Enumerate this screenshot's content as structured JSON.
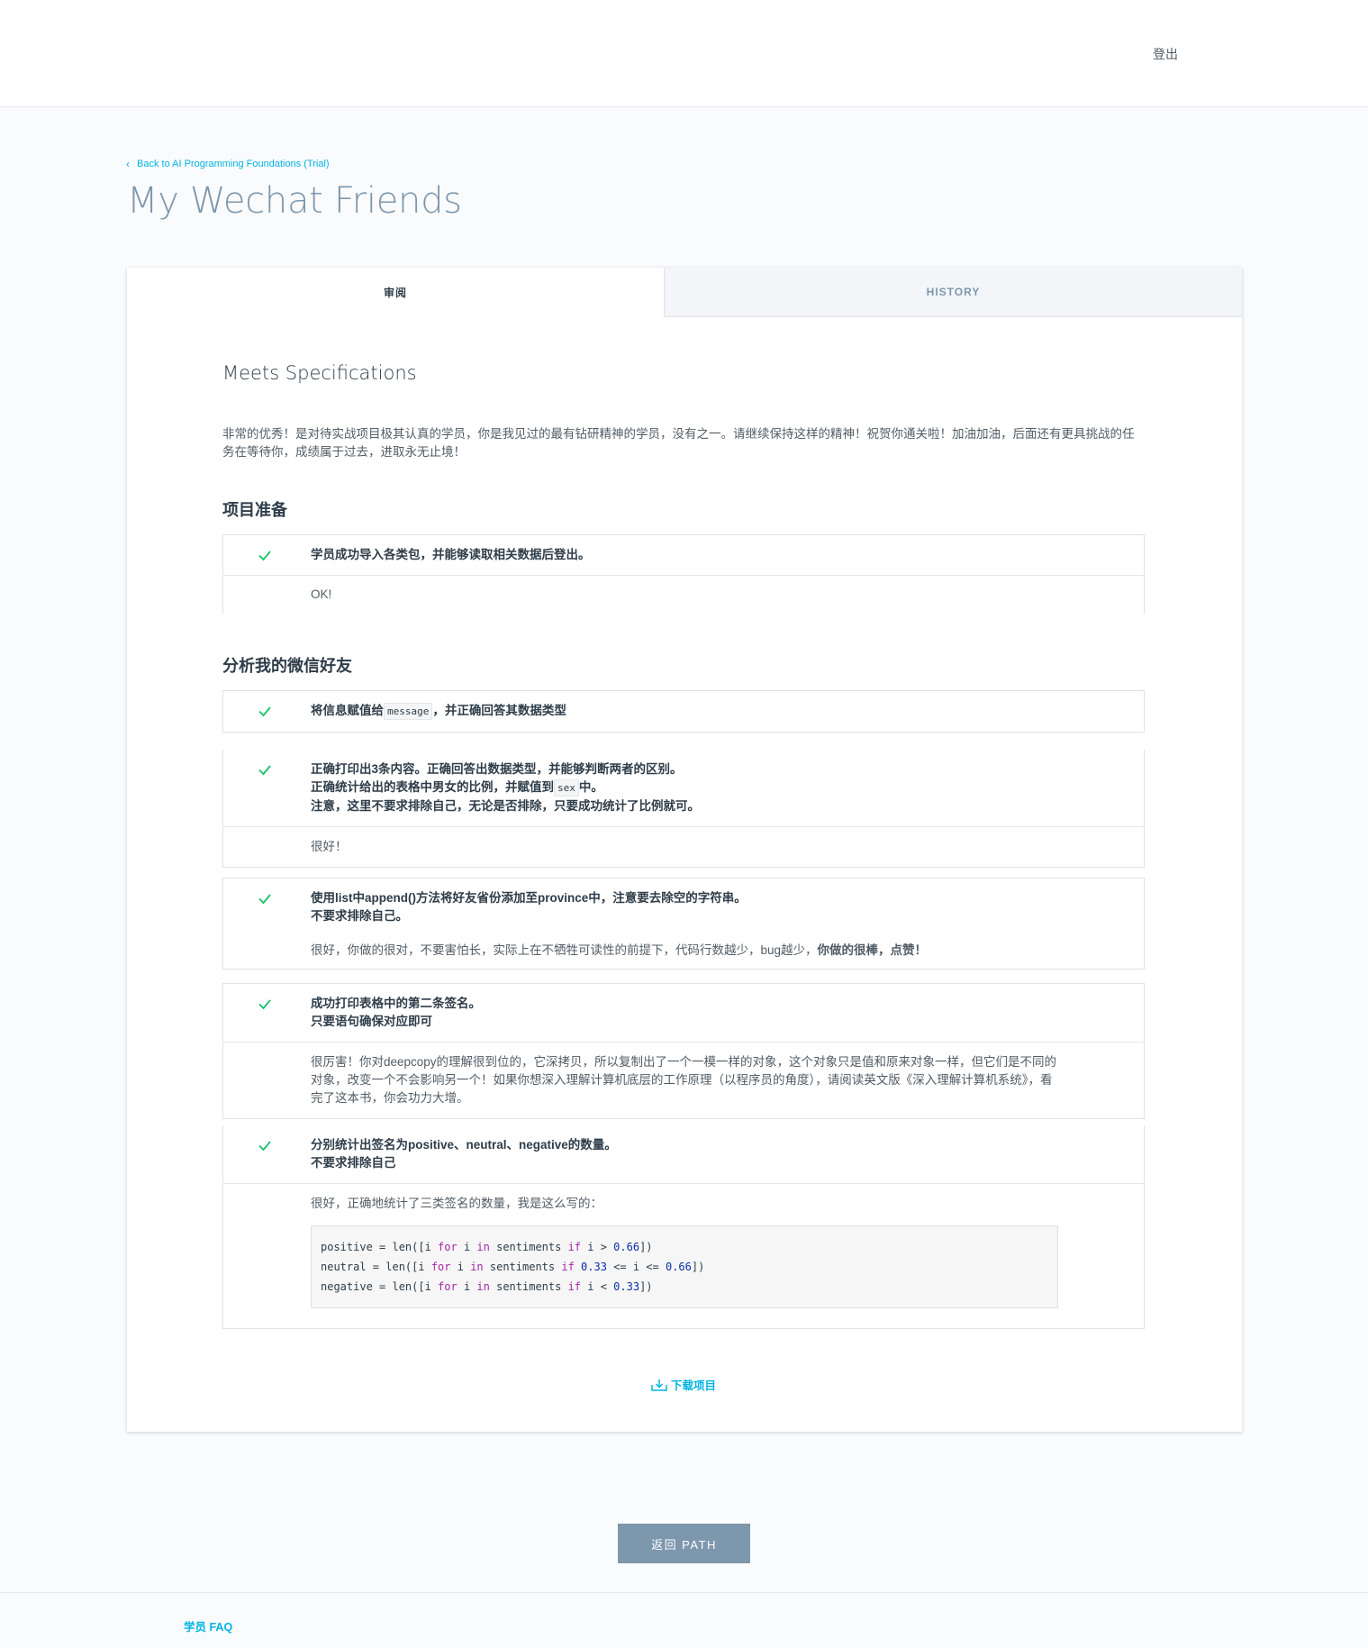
{
  "header": {
    "logout": "登出"
  },
  "nav": {
    "back_link": "Back to AI Programming Foundations (Trial)"
  },
  "page": {
    "title": "My Wechat Friends"
  },
  "tabs": {
    "review": "审阅",
    "history": "HISTORY"
  },
  "review": {
    "status": "Meets Specifications",
    "summary": "非常的优秀！是对待实战项目极其认真的学员，你是我见过的最有钻研精神的学员，没有之一。请继续保持这样的精神！祝贺你通关啦！加油加油，后面还有更具挑战的任务在等待你，成绩属于过去，进取永无止境！",
    "sections": [
      {
        "title": "项目准备",
        "items": [
          {
            "criterion": "学员成功导入各类包，并能够读取相关数据后登出。",
            "feedback": "OK!"
          }
        ]
      },
      {
        "title": "分析我的微信好友",
        "items": [
          {
            "criterion_before": "将信息赋值给",
            "criterion_code": "message",
            "criterion_after": "，并正确回答其数据类型"
          },
          {
            "criterion_line1": "正确打印出3条内容。正确回答出数据类型，并能够判断两者的区别。",
            "criterion_line2_before": "正确统计给出的表格中男女的比例，并赋值到",
            "criterion_line2_code": "sex",
            "criterion_line2_after": "中。",
            "criterion_line3": "注意，这里不要求排除自己，无论是否排除，只要成功统计了比例就可。",
            "feedback": "很好！"
          },
          {
            "criterion_line1": "使用list中append()方法将好友省份添加至province中，注意要去除空的字符串。",
            "criterion_line2": "不要求排除自己。",
            "feedback_plain": "很好，你做的很对，不要害怕长，实际上在不牺牲可读性的前提下，代码行数越少，bug越少，",
            "feedback_bold": "你做的很棒，点赞！"
          },
          {
            "criterion_line1": "成功打印表格中的第二条签名。",
            "criterion_line2": "只要语句确保对应即可",
            "feedback": "很厉害！你对deepcopy的理解很到位的，它深拷贝，所以复制出了一个一模一样的对象，这个对象只是值和原来对象一样，但它们是不同的对象，改变一个不会影响另一个！如果你想深入理解计算机底层的工作原理（以程序员的角度），请阅读英文版《深入理解计算机系统》，看完了这本书，你会功力大增。"
          },
          {
            "criterion_line1": "分别统计出签名为positive、neutral、negative的数量。",
            "criterion_line2": "不要求排除自己",
            "feedback": "很好，正确地统计了三类签名的数量，我是这么写的：",
            "code": {
              "l1_a": "positive = len([i ",
              "l1_kw1": "for",
              "l1_b": " i ",
              "l1_kw2": "in",
              "l1_c": " sentiments ",
              "l1_kw3": "if",
              "l1_d": " i > ",
              "l1_n1": "0.66",
              "l1_e": "])",
              "l2_a": "neutral = len([i ",
              "l2_kw1": "for",
              "l2_b": " i ",
              "l2_kw2": "in",
              "l2_c": " sentiments ",
              "l2_kw3": "if",
              "l2_d": " ",
              "l2_n1": "0.33",
              "l2_e": " <= i <= ",
              "l2_n2": "0.66",
              "l2_f": "])",
              "l3_a": "negative = len([i ",
              "l3_kw1": "for",
              "l3_b": " i ",
              "l3_kw2": "in",
              "l3_c": " sentiments ",
              "l3_kw3": "if",
              "l3_d": " i < ",
              "l3_n1": "0.33",
              "l3_e": "])"
            }
          }
        ]
      }
    ],
    "download": "下载项目"
  },
  "actions": {
    "return": "返回 PATH"
  },
  "footer": {
    "faq": "学员 FAQ"
  },
  "colors": {
    "accent": "#02b3e4",
    "check": "#15c26b",
    "title": "#7d97ad",
    "button": "#7d97ad"
  },
  "icons": {
    "check": "check-icon",
    "download": "download-icon",
    "back": "chevron-left-icon"
  }
}
